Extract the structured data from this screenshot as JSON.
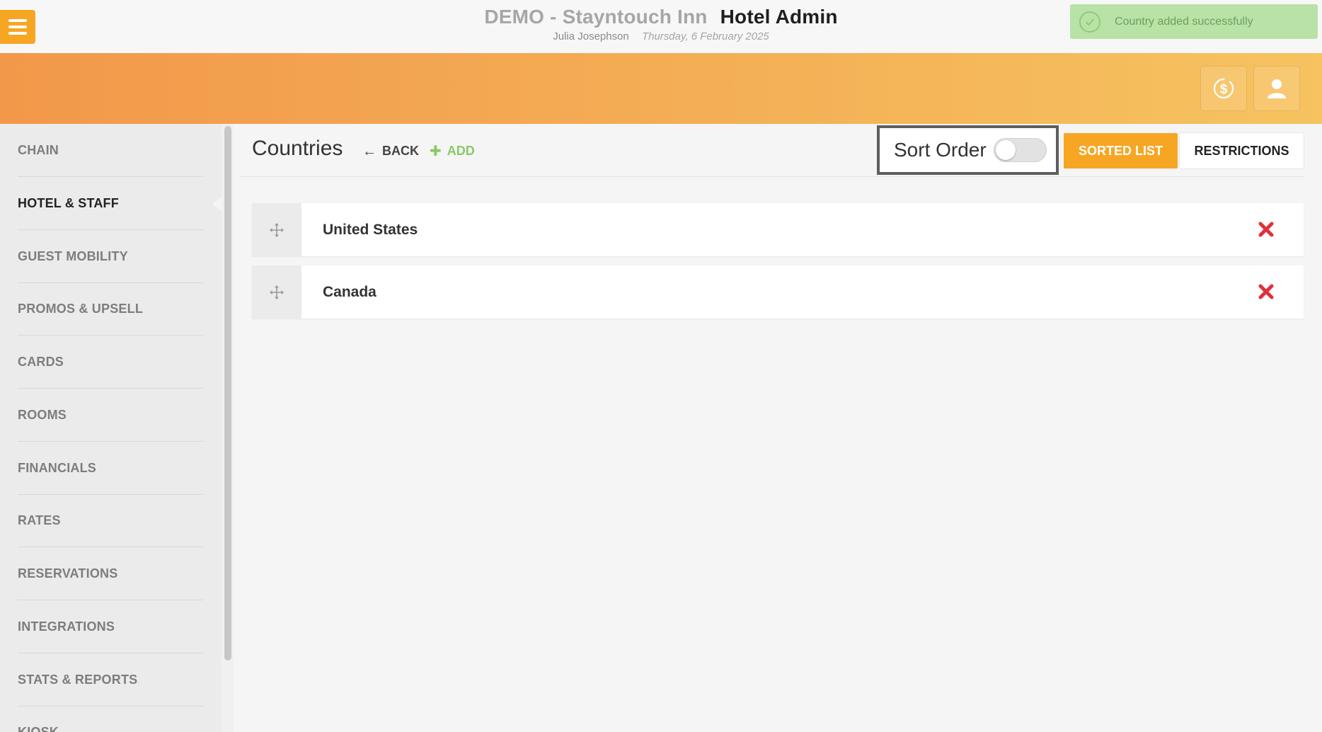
{
  "header": {
    "hotel_name": "DEMO - Stayntouch Inn",
    "app_name": "Hotel Admin",
    "user_name": "Julia Josephson",
    "date": "Thursday, 6 February 2025"
  },
  "toast": {
    "message": "Country added successfully",
    "icon": "check-circle-icon"
  },
  "top_buttons": [
    {
      "name": "cashier",
      "icon": "dollar-circle-icon"
    },
    {
      "name": "user-profile",
      "icon": "user-icon"
    }
  ],
  "sidebar": {
    "active_index": 1,
    "items": [
      {
        "label": "CHAIN"
      },
      {
        "label": "HOTEL & STAFF"
      },
      {
        "label": "GUEST MOBILITY"
      },
      {
        "label": "PROMOS & UPSELL"
      },
      {
        "label": "CARDS"
      },
      {
        "label": "ROOMS"
      },
      {
        "label": "FINANCIALS"
      },
      {
        "label": "RATES"
      },
      {
        "label": "RESERVATIONS"
      },
      {
        "label": "INTEGRATIONS"
      },
      {
        "label": "STATS & REPORTS"
      },
      {
        "label": "KIOSK"
      }
    ]
  },
  "page": {
    "title": "Countries",
    "back_label": "BACK",
    "add_label": "ADD",
    "sort_order_label": "Sort Order",
    "sort_order_enabled": false,
    "tabs": {
      "sorted_list": "SORTED LIST",
      "restrictions": "RESTRICTIONS"
    },
    "active_tab": "sorted_list"
  },
  "countries": [
    {
      "name": "United States"
    },
    {
      "name": "Canada"
    }
  ],
  "colors": {
    "accent": "#f6a623",
    "add_green": "#8cc866",
    "delete_red": "#e0303a",
    "toast_bg": "#b9e2a7"
  }
}
